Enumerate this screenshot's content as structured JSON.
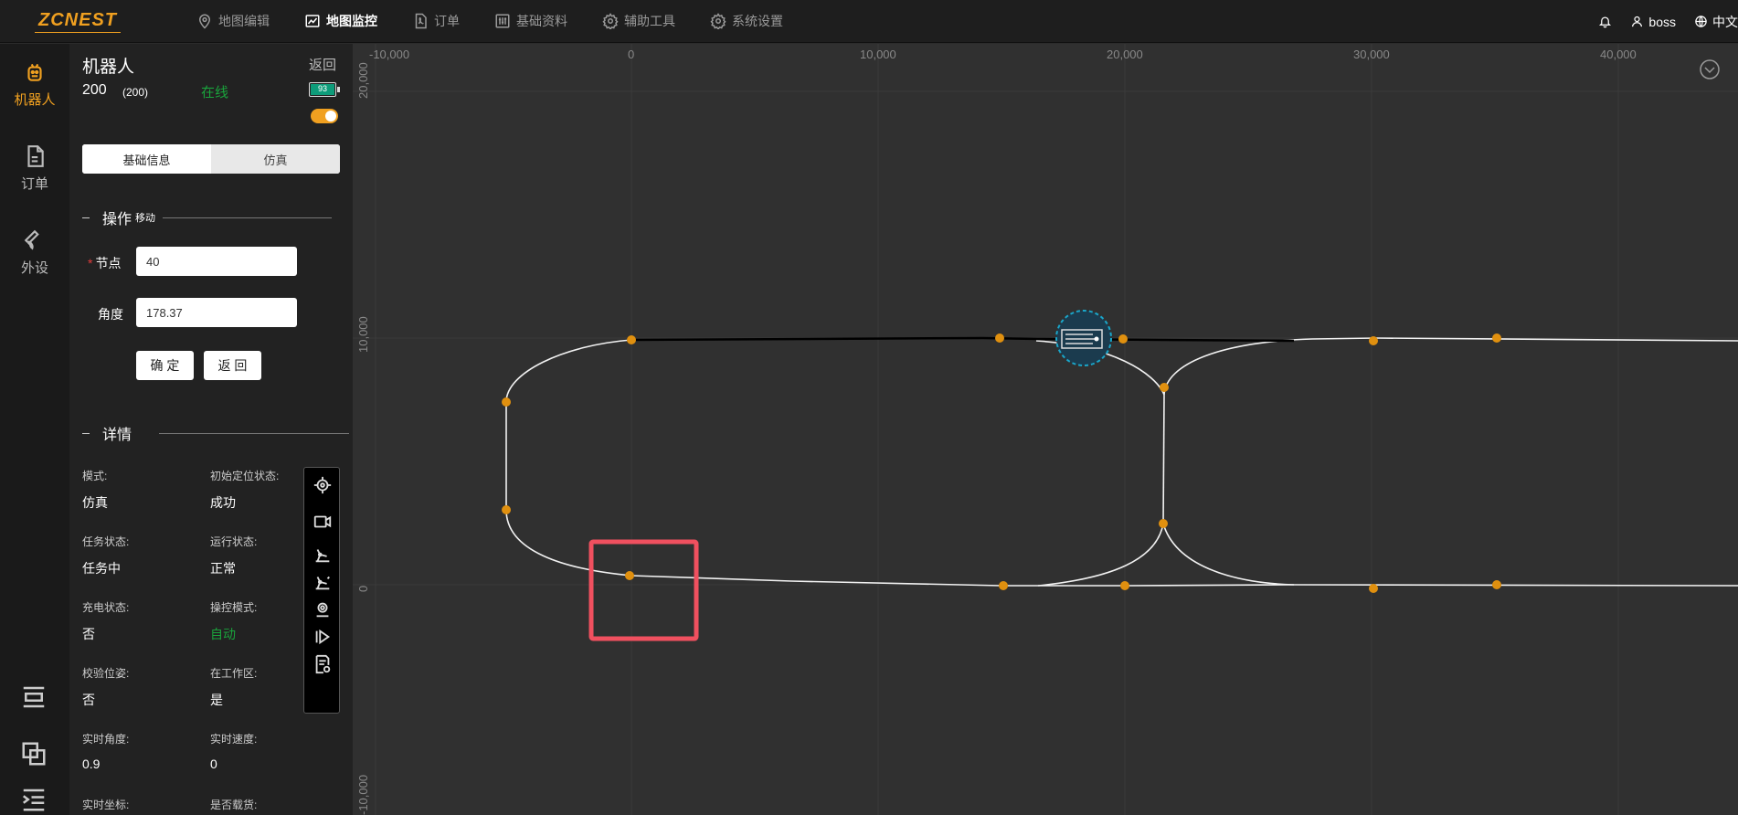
{
  "brand": {
    "logo_text": "ZCNEST",
    "accent": "#f0a020"
  },
  "nav": {
    "items": [
      {
        "label": "地图编辑",
        "icon": "map-pin-icon",
        "active": false
      },
      {
        "label": "地图监控",
        "icon": "chart-line-icon",
        "active": true
      },
      {
        "label": "订单",
        "icon": "document-pdf-icon",
        "active": false
      },
      {
        "label": "基础资料",
        "icon": "sliders-icon",
        "active": false
      },
      {
        "label": "辅助工具",
        "icon": "gear-icon",
        "active": false
      },
      {
        "label": "系统设置",
        "icon": "gear-icon",
        "active": false
      }
    ],
    "user": "boss",
    "language": "中文"
  },
  "sidebar": {
    "items": [
      {
        "label": "机器人",
        "icon": "robot-icon",
        "active": true
      },
      {
        "label": "订单",
        "icon": "document-icon",
        "active": false
      },
      {
        "label": "外设",
        "icon": "wrench-icon",
        "active": false
      }
    ]
  },
  "panel": {
    "title": "机器人",
    "back": "返回",
    "robot_id": "200",
    "robot_id_sub": "(200)",
    "status": "在线",
    "battery": "93",
    "tabs": [
      {
        "label": "基础信息",
        "active": true
      },
      {
        "label": "仿真",
        "active": false
      }
    ],
    "operation": {
      "title": "操作",
      "subtitle": "移动",
      "node_label": "节点",
      "node_value": "40",
      "angle_label": "角度",
      "angle_value": "178.37",
      "confirm": "确 定",
      "back": "返 回"
    },
    "details": {
      "title": "详情",
      "fields": [
        {
          "label": "模式:",
          "value": "仿真"
        },
        {
          "label": "初始定位状态:",
          "value": "成功"
        },
        {
          "label": "任务状态:",
          "value": "任务中"
        },
        {
          "label": "运行状态:",
          "value": "正常"
        },
        {
          "label": "充电状态:",
          "value": "否"
        },
        {
          "label": "操控模式:",
          "value": "自动"
        },
        {
          "label": "校验位姿:",
          "value": "否"
        },
        {
          "label": "在工作区:",
          "value": "是"
        },
        {
          "label": "实时角度:",
          "value": "0.9"
        },
        {
          "label": "实时速度:",
          "value": "0"
        },
        {
          "label": "实时坐标:",
          "value": ""
        },
        {
          "label": "是否载货:",
          "value": ""
        }
      ]
    },
    "tools": [
      "crosshair-icon",
      "camera-icon",
      "robot-arm-icon",
      "robot-arm-alt-icon",
      "location-icon",
      "play-step-icon",
      "report-icon"
    ]
  },
  "map": {
    "x_ticks": [
      "-10,000",
      "0",
      "10,000",
      "20,000",
      "30,000",
      "40,000"
    ],
    "y_ticks": [
      "20,000",
      "10,000",
      "0",
      "-10,000"
    ],
    "path_color": "#ffffff",
    "node_color": "#e0900f",
    "robot_color": "#1aa6c9",
    "highlight_color": "#f0505f"
  }
}
